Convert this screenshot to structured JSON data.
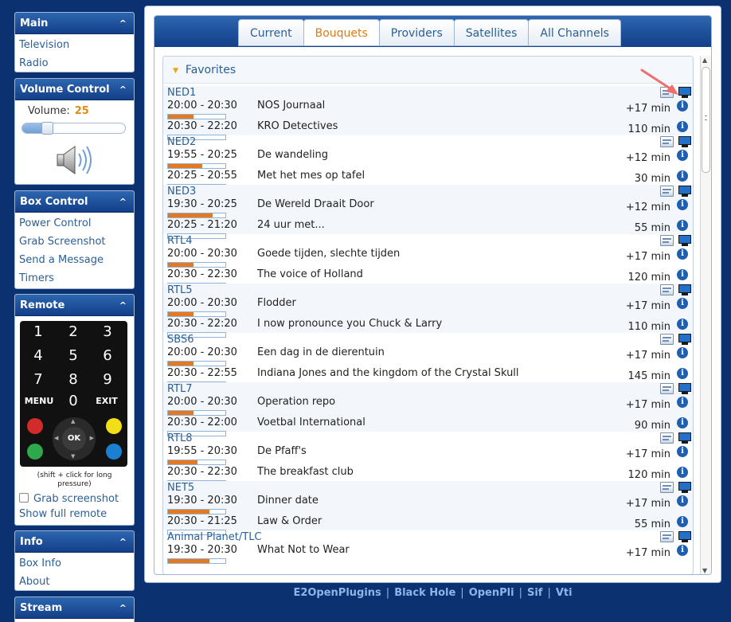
{
  "sidebar": {
    "main": {
      "title": "Main",
      "items": [
        "Television",
        "Radio"
      ]
    },
    "volume": {
      "title": "Volume Control",
      "label": "Volume:",
      "value": "25",
      "level_percent": 25
    },
    "box_control": {
      "title": "Box Control",
      "items": [
        "Power Control",
        "Grab Screenshot",
        "Send a Message",
        "Timers"
      ]
    },
    "remote": {
      "title": "Remote",
      "keys": [
        "1",
        "2",
        "3",
        "4",
        "5",
        "6",
        "7",
        "8",
        "9",
        "MENU",
        "0",
        "EXIT"
      ],
      "ok": "OK",
      "note": "(shift + click for long pressure)",
      "grab_label": "Grab screenshot",
      "show_full": "Show full remote",
      "colors": {
        "red": "#d32b2b",
        "yellow": "#f2de16",
        "green": "#2ea84a",
        "blue": "#1b7fd2"
      }
    },
    "info": {
      "title": "Info",
      "items": [
        "Box Info",
        "About"
      ]
    },
    "stream": {
      "title": "Stream"
    }
  },
  "tabs": [
    "Current",
    "Bouquets",
    "Providers",
    "Satellites",
    "All Channels"
  ],
  "active_tab": "Bouquets",
  "bouquet": {
    "name": "Favorites"
  },
  "channels": [
    {
      "name": "NED1",
      "events": [
        {
          "time": "20:00 - 20:30",
          "title": "NOS Journaal",
          "remaining": "+17 min",
          "progress": 0.45
        },
        {
          "time": "20:30 - 22:20",
          "title": "KRO Detectives",
          "remaining": "110 min",
          "progress": 0
        }
      ]
    },
    {
      "name": "NED2",
      "events": [
        {
          "time": "19:55 - 20:25",
          "title": "De wandeling",
          "remaining": "+12 min",
          "progress": 0.6
        },
        {
          "time": "20:25 - 20:55",
          "title": "Met het mes op tafel",
          "remaining": "30 min",
          "progress": 0
        }
      ]
    },
    {
      "name": "NED3",
      "events": [
        {
          "time": "19:30 - 20:25",
          "title": "De Wereld Draait Door",
          "remaining": "+12 min",
          "progress": 0.78
        },
        {
          "time": "20:25 - 21:20",
          "title": "24 uur met...",
          "remaining": "55 min",
          "progress": 0
        }
      ]
    },
    {
      "name": "RTL4",
      "events": [
        {
          "time": "20:00 - 20:30",
          "title": "Goede tijden, slechte tijden",
          "remaining": "+17 min",
          "progress": 0.45
        },
        {
          "time": "20:30 - 22:30",
          "title": "The voice of Holland",
          "remaining": "120 min",
          "progress": 0
        }
      ]
    },
    {
      "name": "RTL5",
      "events": [
        {
          "time": "20:00 - 20:30",
          "title": "Flodder",
          "remaining": "+17 min",
          "progress": 0.45
        },
        {
          "time": "20:30 - 22:20",
          "title": "I now pronounce you Chuck & Larry",
          "remaining": "110 min",
          "progress": 0
        }
      ]
    },
    {
      "name": "SBS6",
      "events": [
        {
          "time": "20:00 - 20:30",
          "title": "Een dag in de dierentuin",
          "remaining": "+17 min",
          "progress": 0.45
        },
        {
          "time": "20:30 - 22:55",
          "title": "Indiana Jones and the kingdom of the Crystal Skull",
          "remaining": "145 min",
          "progress": 0
        }
      ]
    },
    {
      "name": "RTL7",
      "events": [
        {
          "time": "20:00 - 20:30",
          "title": "Operation repo",
          "remaining": "+17 min",
          "progress": 0.45
        },
        {
          "time": "20:30 - 22:00",
          "title": "Voetbal International",
          "remaining": "90 min",
          "progress": 0
        }
      ]
    },
    {
      "name": "RTL8",
      "events": [
        {
          "time": "19:55 - 20:30",
          "title": "De Pfaff's",
          "remaining": "+17 min",
          "progress": 0.52
        },
        {
          "time": "20:30 - 22:30",
          "title": "The breakfast club",
          "remaining": "120 min",
          "progress": 0
        }
      ]
    },
    {
      "name": "NET5",
      "events": [
        {
          "time": "19:30 - 20:30",
          "title": "Dinner date",
          "remaining": "+17 min",
          "progress": 0.72
        },
        {
          "time": "20:30 - 21:25",
          "title": "Law & Order",
          "remaining": "55 min",
          "progress": 0
        }
      ]
    },
    {
      "name": "Animal Planet/TLC",
      "events": [
        {
          "time": "19:30 - 20:30",
          "title": "What Not to Wear",
          "remaining": "+17 min",
          "progress": 0.72
        }
      ]
    }
  ],
  "footer": {
    "links": [
      "E2OpenPlugins",
      "Black Hole",
      "OpenPli",
      "Sif",
      "Vti"
    ]
  },
  "colors": {
    "header_blue": "#1c4f9c",
    "accent_orange": "#e07a10",
    "link_blue": "#2a5f96"
  }
}
